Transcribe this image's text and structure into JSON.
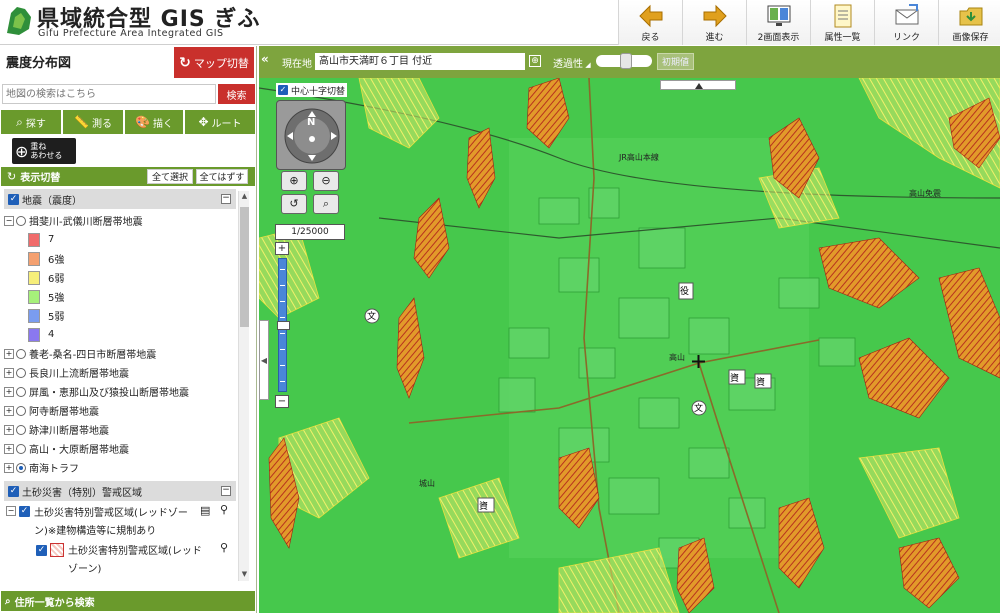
{
  "header": {
    "title": "県域統合型 GIS ぎふ",
    "subtitle": "Gifu Prefecture Area Integrated GIS",
    "toolbar": [
      {
        "label": "戻る",
        "icon": "back-arrow-icon"
      },
      {
        "label": "進む",
        "icon": "forward-arrow-icon"
      },
      {
        "label": "2画面表示",
        "icon": "dual-screen-icon"
      },
      {
        "label": "属性一覧",
        "icon": "attribute-list-icon"
      },
      {
        "label": "リンク",
        "icon": "link-envelope-icon"
      },
      {
        "label": "画像保存",
        "icon": "save-folder-icon"
      }
    ]
  },
  "panel": {
    "title": "震度分布図",
    "map_switch_label": "マップ切替",
    "search_placeholder": "地図の検索はこちら",
    "search_button": "検索",
    "tools": [
      {
        "label": "探す",
        "icon": "magnifier-icon"
      },
      {
        "label": "測る",
        "icon": "ruler-icon"
      },
      {
        "label": "描く",
        "icon": "palette-icon"
      },
      {
        "label": "ルート",
        "icon": "route-icon"
      }
    ],
    "overlay_label_1": "重ね",
    "overlay_label_2": "あわせる",
    "layers_title": "表示切替",
    "select_all": "全て選択",
    "deselect_all": "全てはずす",
    "section1": "地震（震度）",
    "fault_active": "揖斐川-武儀川断層帯地震",
    "legend": [
      {
        "label": "7",
        "color": "#f06b6b"
      },
      {
        "label": "6強",
        "color": "#f4a070"
      },
      {
        "label": "6弱",
        "color": "#f6ee7a"
      },
      {
        "label": "5強",
        "color": "#a6f07a"
      },
      {
        "label": "5弱",
        "color": "#7a9cf0"
      },
      {
        "label": "4",
        "color": "#8a78f0"
      }
    ],
    "faults": [
      "養老-桑名-四日市断層帯地震",
      "長良川上流断層帯地震",
      "屏風・恵那山及び猿投山断層帯地震",
      "阿寺断層帯地震",
      "跡津川断層帯地震",
      "高山・大原断層帯地震",
      "南海トラフ"
    ],
    "section2": "土砂災害（特別）警戒区域",
    "sub_layer_line1": "土砂災害特別警戒区域(レッドゾー",
    "sub_layer_line2": "ン)※建物構造等に規制あり",
    "sub_item_line1": "土砂災害特別警戒区域(レッド",
    "sub_item_line2": "ゾーン)",
    "address_search": "住所一覧から検索"
  },
  "location_bar": {
    "label": "現在地",
    "value": "高山市天満町６丁目 付近",
    "transparency_label": "透過性",
    "transparency_level": 0.55,
    "reset_label": "初期値"
  },
  "map": {
    "crosshair_label": "中心十字切替",
    "scale": "1/25000",
    "labels": [
      {
        "text": "JR高山本線"
      },
      {
        "text": "高山"
      },
      {
        "text": "城山"
      },
      {
        "text": "高山免震"
      }
    ]
  }
}
